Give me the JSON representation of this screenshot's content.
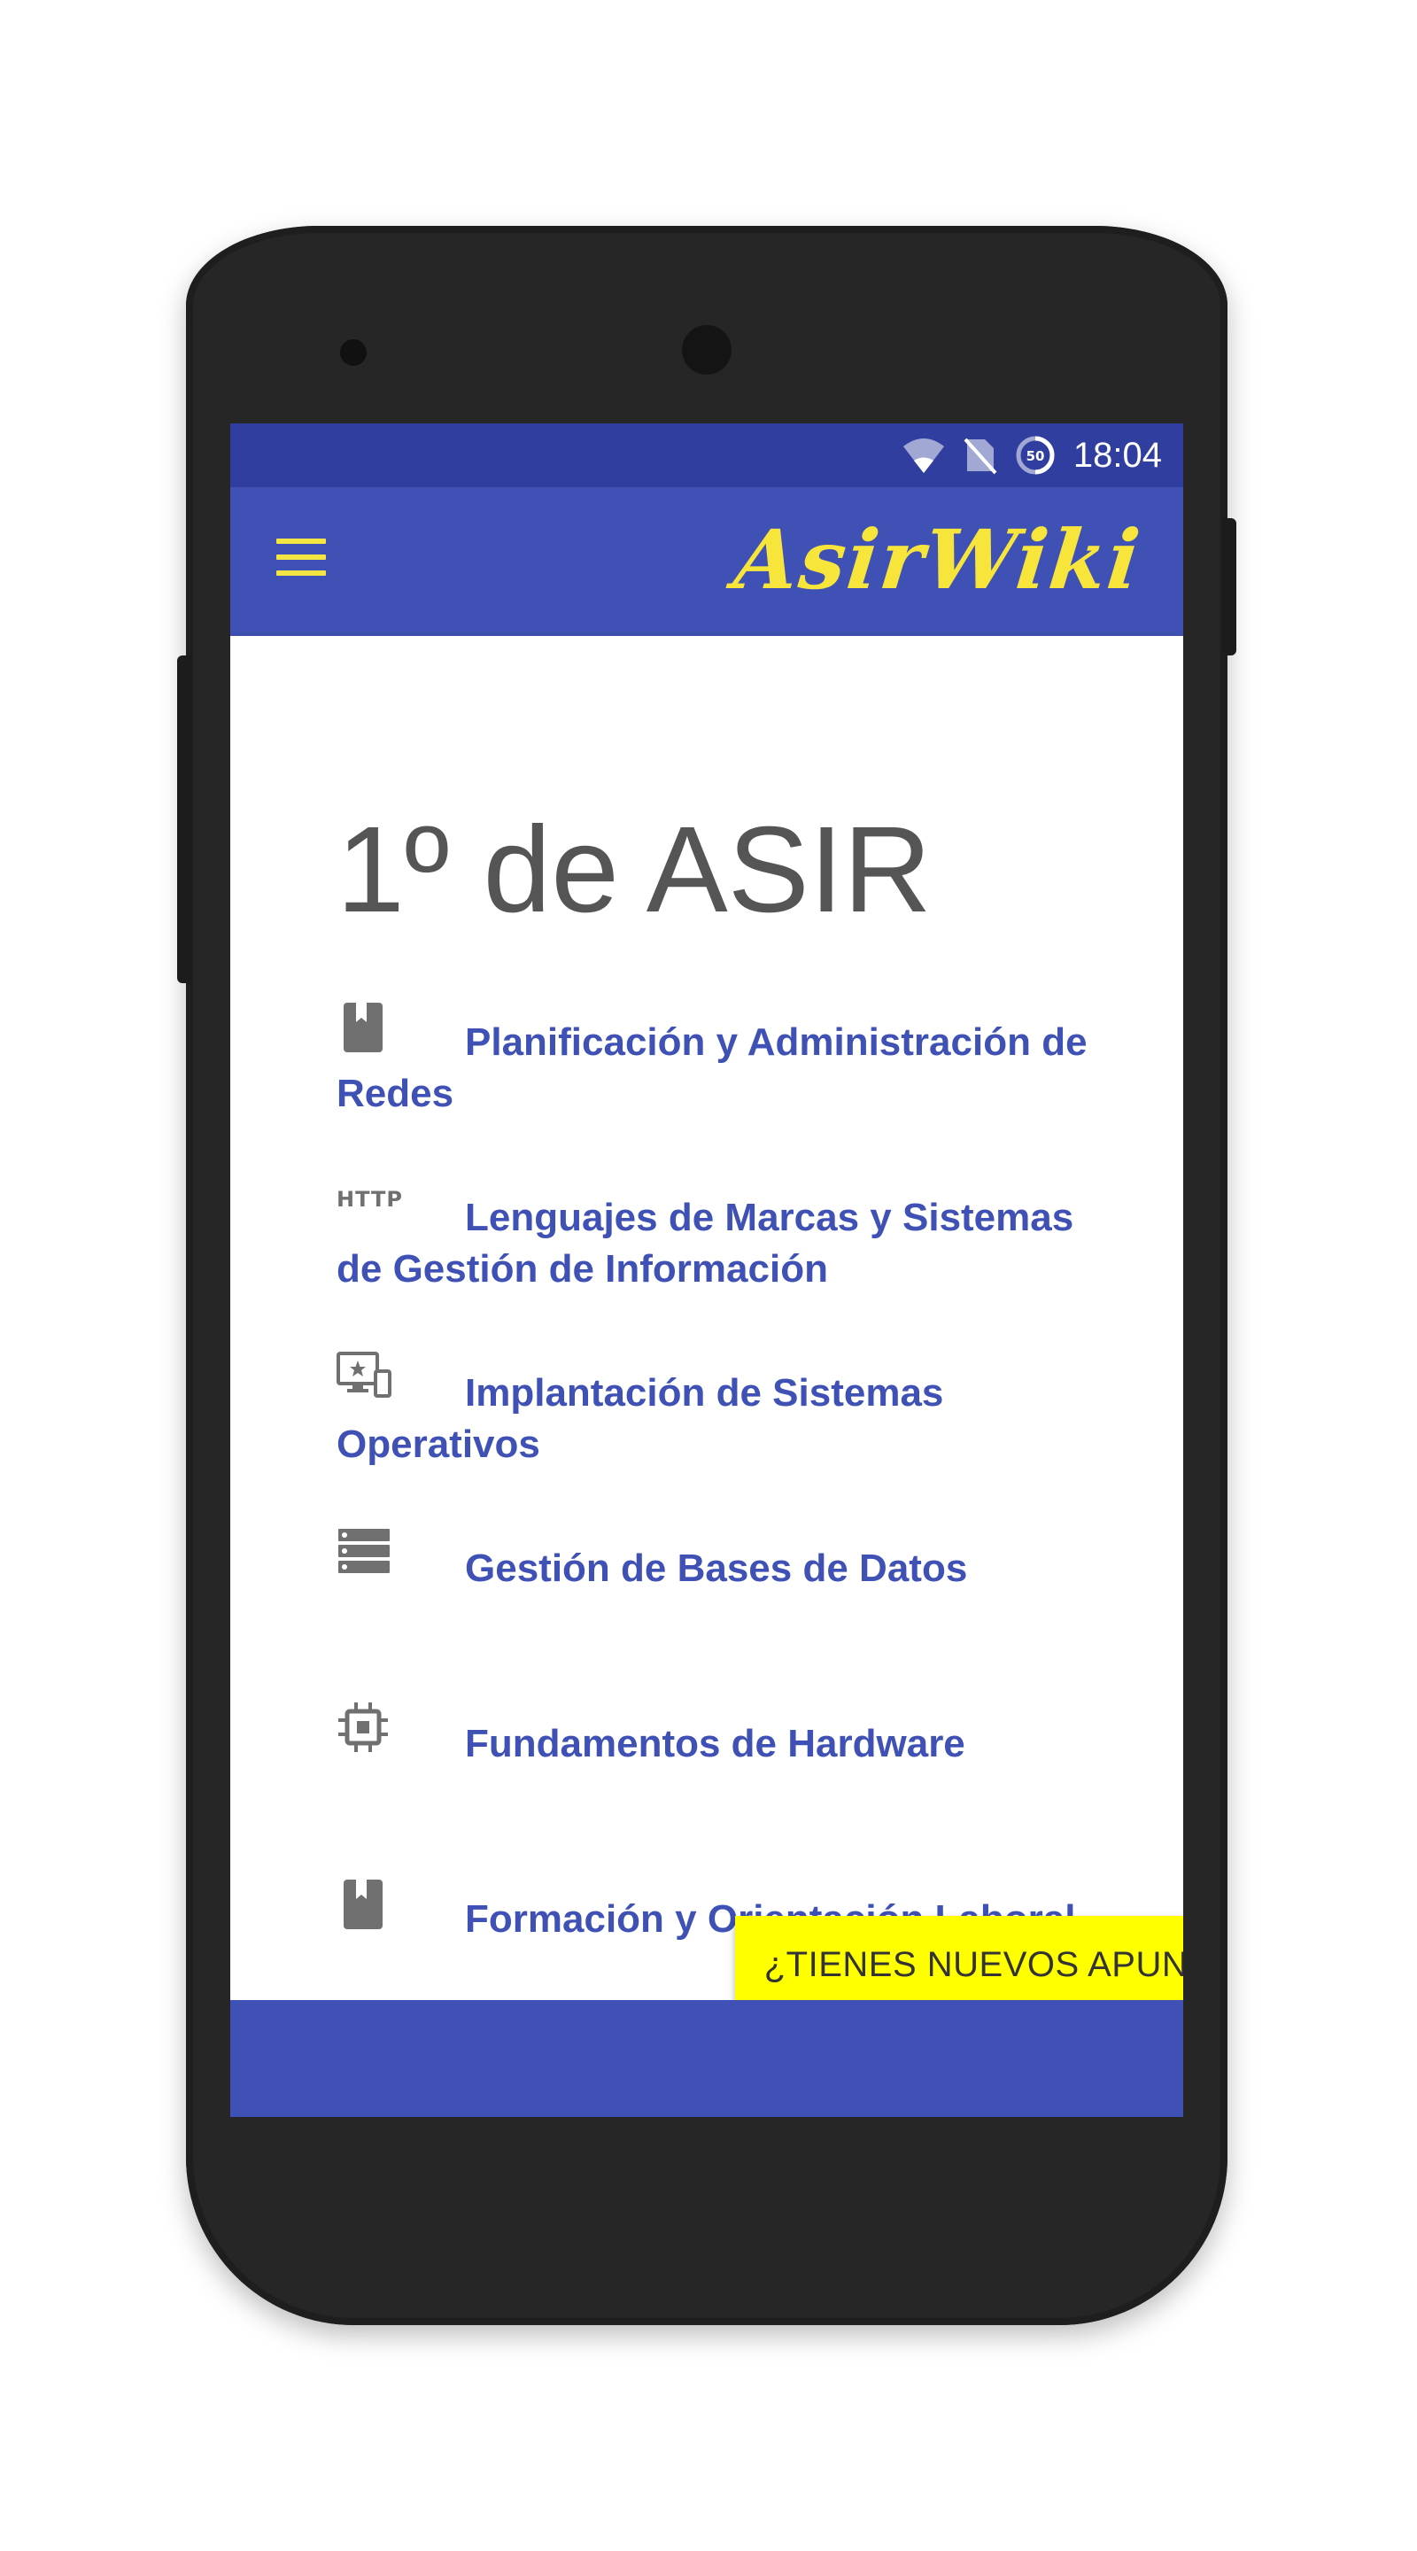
{
  "status_bar": {
    "time": "18:04",
    "battery_level": "50",
    "icons": [
      "wifi-icon",
      "no-sim-icon",
      "battery-saver-icon"
    ]
  },
  "app_bar": {
    "brand": "AsirWiki",
    "menu_icon": "hamburger-menu-icon"
  },
  "page": {
    "title": "1º de ASIR"
  },
  "courses": [
    {
      "label": "Planificación y Administración de Redes",
      "icon": "book-icon"
    },
    {
      "label": "Lenguajes de Marcas y Sistemas de Gestión de Información",
      "icon": "http-icon",
      "icon_text": "HTTP"
    },
    {
      "label": "Implantación de Sistemas Operativos",
      "icon": "devices-star-icon"
    },
    {
      "label": "Gestión de Bases de Datos",
      "icon": "database-icon"
    },
    {
      "label": "Fundamentos de Hardware",
      "icon": "chip-icon"
    },
    {
      "label": "Formación y Orientación Laboral",
      "icon": "book-icon"
    }
  ],
  "action_button": {
    "label": "¿TIENES NUEVOS APUNTES?"
  },
  "colors": {
    "primary": "#3f51b5",
    "primary_dark": "#303f9f",
    "accent": "#f7e53b",
    "fab": "#ffff00",
    "link": "#3f51b5"
  }
}
